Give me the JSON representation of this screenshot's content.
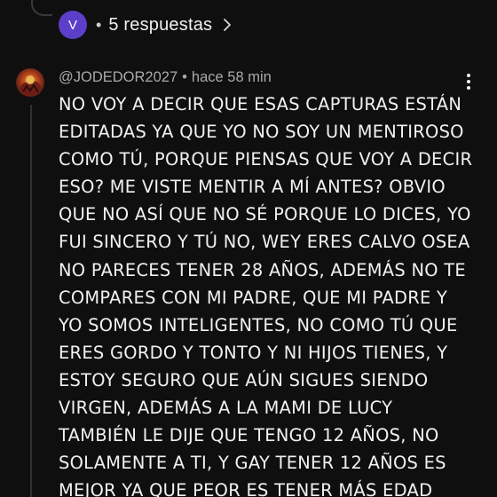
{
  "replies": {
    "avatar_letter": "V",
    "dot": "•",
    "label": "5 respuestas",
    "avatar_color": "#5b3fc9"
  },
  "comment": {
    "author": "@JODEDOR2027",
    "separator": "•",
    "time": "hace 58 min",
    "text": "NO VOY A DECIR QUE ESAS CAPTURAS ESTÁN\nEDITADAS YA QUE YO NO SOY UN MENTIROSO\nCOMO TÚ, PORQUE PIENSAS QUE VOY A DECIR\nESO? ME VISTE MENTIR A MÍ ANTES? OBVIO\nQUE NO ASÍ QUE NO SÉ PORQUE LO DICES, YO\nFUI SINCERO Y TÚ NO, WEY ERES CALVO OSEA\nNO PARECES TENER 28 AÑOS, ADEMÁS NO TE\nCOMPARES CON MI PADRE, QUE MI PADRE Y\nYO SOMOS INTELIGENTES, NO COMO TÚ QUE\nERES GORDO Y TONTO Y NI HIJOS TIENES, Y\nESTOY SEGURO QUE AÚN SIGUES SIENDO\nVIRGEN, ADEMÁS A LA MAMI DE LUCY\nTAMBIÉN LE DIJE QUE TENGO 12 AÑOS, NO\nSOLAMENTE A TI, Y GAY TENER 12 AÑOS ES\nMEJOR YA QUE PEOR ES TENER MÁS EDAD"
  },
  "icons": {
    "chevron": "chevron-right-icon",
    "menu": "more-vert-icon"
  },
  "colors": {
    "background": "#0f0f0f",
    "text": "#f1f1f1",
    "secondary_text": "#aaaaaa"
  }
}
